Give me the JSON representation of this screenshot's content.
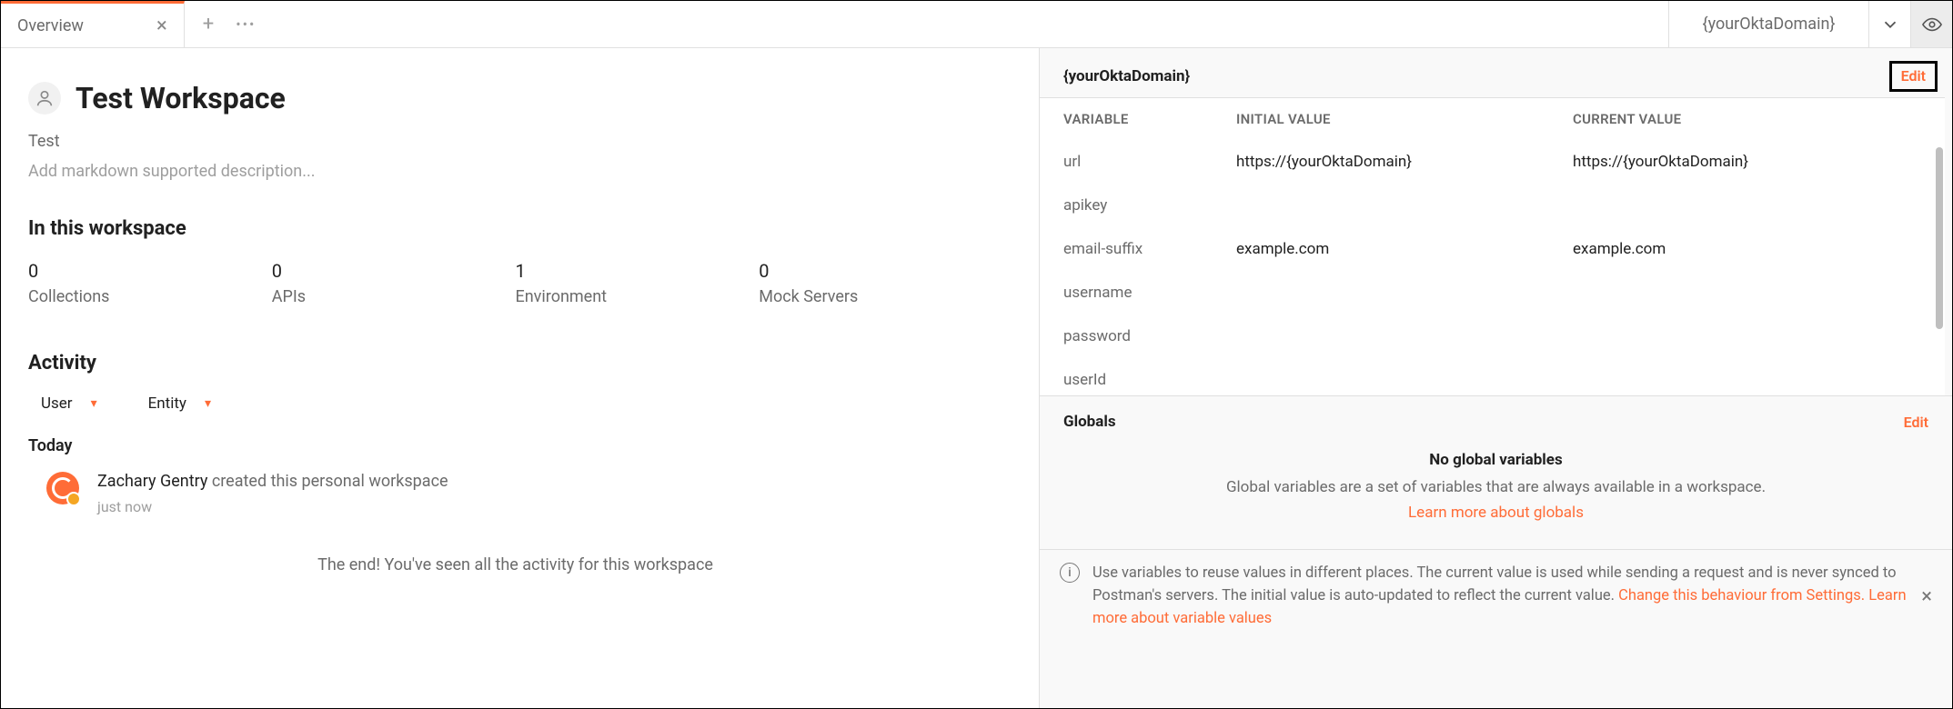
{
  "tabbar": {
    "tab_label": "Overview",
    "env_label": "{yourOktaDomain}"
  },
  "overview": {
    "title": "Test Workspace",
    "subtitle": "Test",
    "description_placeholder": "Add markdown supported description...",
    "section_in": "In this workspace",
    "stats": [
      {
        "value": "0",
        "label": "Collections"
      },
      {
        "value": "0",
        "label": "APIs"
      },
      {
        "value": "1",
        "label": "Environment"
      },
      {
        "value": "0",
        "label": "Mock Servers"
      }
    ],
    "section_activity": "Activity",
    "filters": {
      "user": "User",
      "entity": "Entity"
    },
    "today_label": "Today",
    "activity": {
      "who": "Zachary Gentry",
      "text": " created this personal workspace",
      "when": "just now"
    },
    "end": "The end! You've seen all the activity for this workspace"
  },
  "envpanel": {
    "name": "{yourOktaDomain}",
    "edit": "Edit",
    "headers": {
      "var": "VARIABLE",
      "init": "INITIAL VALUE",
      "cur": "CURRENT VALUE"
    },
    "rows": [
      {
        "k": "url",
        "i": "https://{yourOktaDomain}",
        "c": "https://{yourOktaDomain}"
      },
      {
        "k": "apikey",
        "i": "",
        "c": ""
      },
      {
        "k": "email-suffix",
        "i": "example.com",
        "c": "example.com"
      },
      {
        "k": "username",
        "i": "",
        "c": ""
      },
      {
        "k": "password",
        "i": "",
        "c": ""
      },
      {
        "k": "userId",
        "i": "",
        "c": ""
      }
    ]
  },
  "globals": {
    "title": "Globals",
    "edit": "Edit",
    "empty_title": "No global variables",
    "empty_text": "Global variables are a set of variables that are always available in a workspace.",
    "learn": "Learn more about globals"
  },
  "infobar": {
    "text1": "Use variables to reuse values in different places. The current value is used while sending a request and is never synced to Postman's servers. The initial value is auto-updated to reflect the current value. ",
    "link1": "Change this behaviour from Settings.",
    "text2": " ",
    "link2": "Learn more about variable values"
  }
}
